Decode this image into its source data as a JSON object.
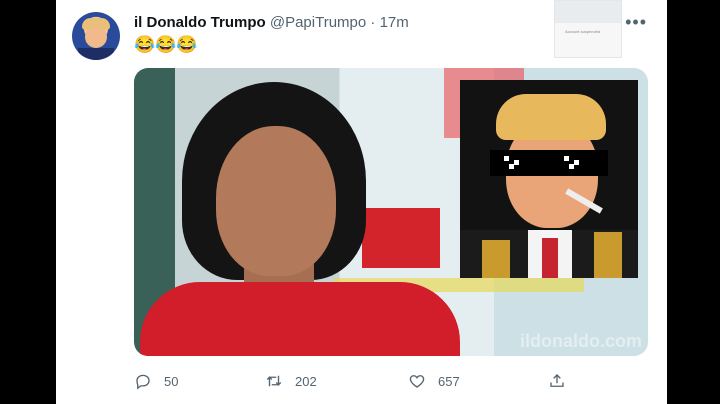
{
  "tweet": {
    "display_name": "il Donaldo Trumpo",
    "handle": "@PapiTrumpo",
    "separator": "·",
    "time": "17m",
    "text": "😂😂😂",
    "more_icon": "more-horizontal-icon"
  },
  "media": {
    "watermark": "ildonaldo.com"
  },
  "preview_thumb": {
    "line1": "Account suspended",
    "line2": ""
  },
  "actions": {
    "reply": {
      "icon": "reply-icon",
      "count": "50"
    },
    "retweet": {
      "icon": "retweet-icon",
      "count": "202"
    },
    "like": {
      "icon": "like-icon",
      "count": "657"
    },
    "share": {
      "icon": "share-icon"
    }
  },
  "colors": {
    "text_primary": "#0f1419",
    "text_secondary": "#536471",
    "card_bg": "#ffffff"
  }
}
